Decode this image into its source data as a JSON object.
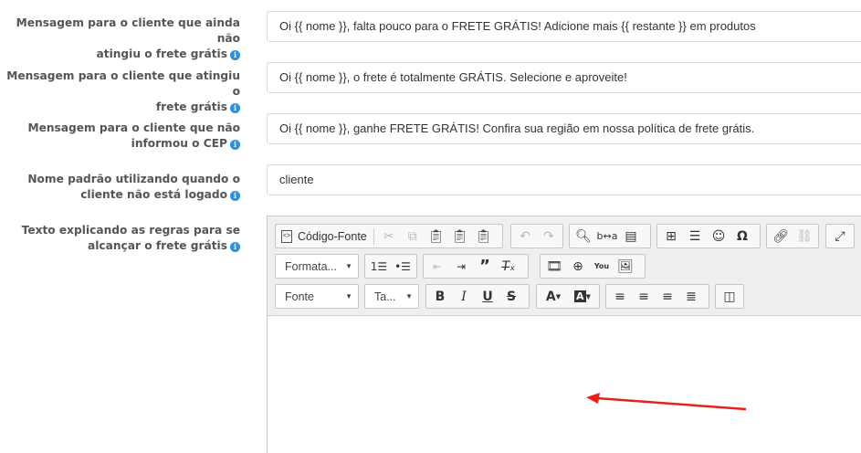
{
  "fields": [
    {
      "label": "Mensagem para o cliente que ainda não atingiu o frete grátis",
      "value": "Oi {{ nome }}, falta pouco para o FRETE GRÁTIS! Adicione mais {{ restante }} em produtos"
    },
    {
      "label": "Mensagem para o cliente que atingiu o frete grátis",
      "value": "Oi {{ nome }}, o frete é totalmente GRÁTIS. Selecione e aproveite!"
    },
    {
      "label": "Mensagem para o cliente que não informou o CEP",
      "value": "Oi {{ nome }}, ganhe FRETE GRÁTIS! Confira sua região em nossa política de frete grátis."
    },
    {
      "label": "Nome padrão utilizando quando o cliente não está logado",
      "value": "cliente"
    },
    {
      "label": "Texto explicando as regras para se alcançar o frete grátis"
    }
  ],
  "label_lines": [
    [
      "Mensagem para o cliente que ainda não",
      "atingiu o frete grátis"
    ],
    [
      "Mensagem para o cliente que atingiu o",
      "frete grátis"
    ],
    [
      "Mensagem para o cliente que não",
      "informou o CEP"
    ],
    [
      "Nome padrão utilizando quando o",
      "cliente não está logado"
    ],
    [
      "Texto explicando as regras para se",
      "alcançar o frete grátis"
    ]
  ],
  "editor": {
    "source_button": "Código-Fonte",
    "format_combo": "Formata...",
    "font_combo": "Fonte",
    "size_combo": "Ta...",
    "icons": {
      "info": "info-icon",
      "arrow_color": "#e8201a"
    }
  }
}
